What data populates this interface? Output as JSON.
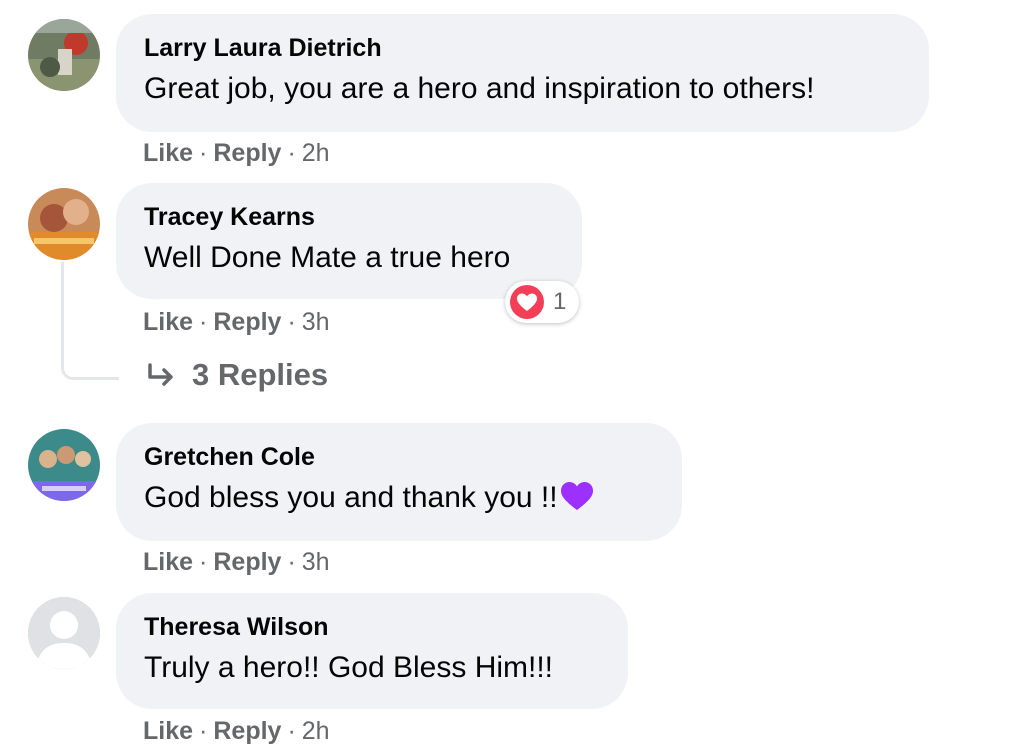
{
  "comments": [
    {
      "author": "Larry Laura Dietrich",
      "text": "Great job, you are a hero and inspiration to others!",
      "like": "Like",
      "reply": "Reply",
      "time": "2h"
    },
    {
      "author": "Tracey Kearns",
      "text": "Well Done Mate a true hero",
      "like": "Like",
      "reply": "Reply",
      "time": "3h",
      "reaction": {
        "icon": "love-reaction-icon",
        "count": "1"
      },
      "replies_label": "3 Replies"
    },
    {
      "author": "Gretchen Cole",
      "text": "God bless you and thank you !!",
      "emoji": "purple-heart-emoji",
      "like": "Like",
      "reply": "Reply",
      "time": "3h"
    },
    {
      "author": "Theresa Wilson",
      "text": "Truly a hero!! God Bless Him!!!",
      "like": "Like",
      "reply": "Reply",
      "time": "2h"
    }
  ],
  "separator": "·",
  "colors": {
    "bubble": "#f0f2f5",
    "meta": "#65676b",
    "love": "#f33e58",
    "purple_heart": "#9b30ff"
  }
}
